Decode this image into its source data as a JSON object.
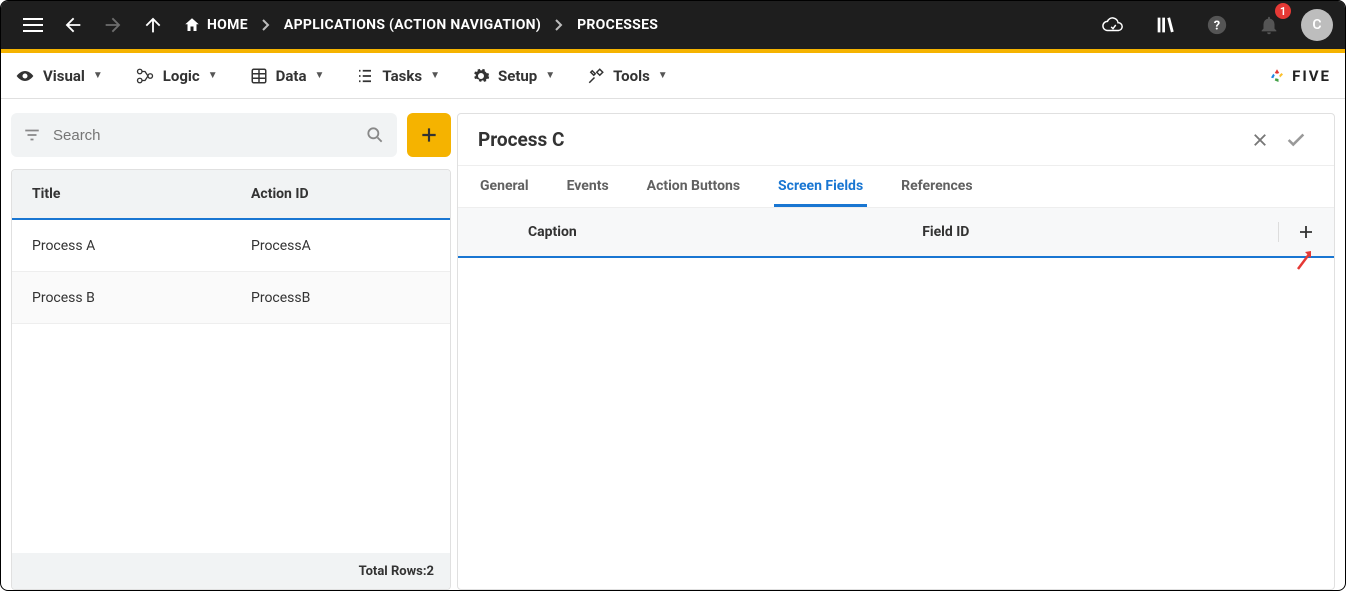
{
  "appbar": {
    "breadcrumb": {
      "home": "HOME",
      "apps": "APPLICATIONS (ACTION NAVIGATION)",
      "processes": "PROCESSES"
    },
    "notifications_count": "1",
    "avatar_letter": "C"
  },
  "toolbar": {
    "visual": "Visual",
    "logic": "Logic",
    "data": "Data",
    "tasks": "Tasks",
    "setup": "Setup",
    "tools": "Tools",
    "brand": "FIVE"
  },
  "search": {
    "placeholder": "Search"
  },
  "list": {
    "col_title": "Title",
    "col_action": "Action ID",
    "rows": [
      {
        "title": "Process A",
        "action_id": "ProcessA"
      },
      {
        "title": "Process B",
        "action_id": "ProcessB"
      }
    ],
    "footer_label": "Total Rows: ",
    "footer_count": "2"
  },
  "detail": {
    "title": "Process C",
    "tabs": {
      "general": "General",
      "events": "Events",
      "action_buttons": "Action Buttons",
      "screen_fields": "Screen Fields",
      "references": "References"
    },
    "subhead": {
      "caption": "Caption",
      "field_id": "Field ID"
    }
  }
}
